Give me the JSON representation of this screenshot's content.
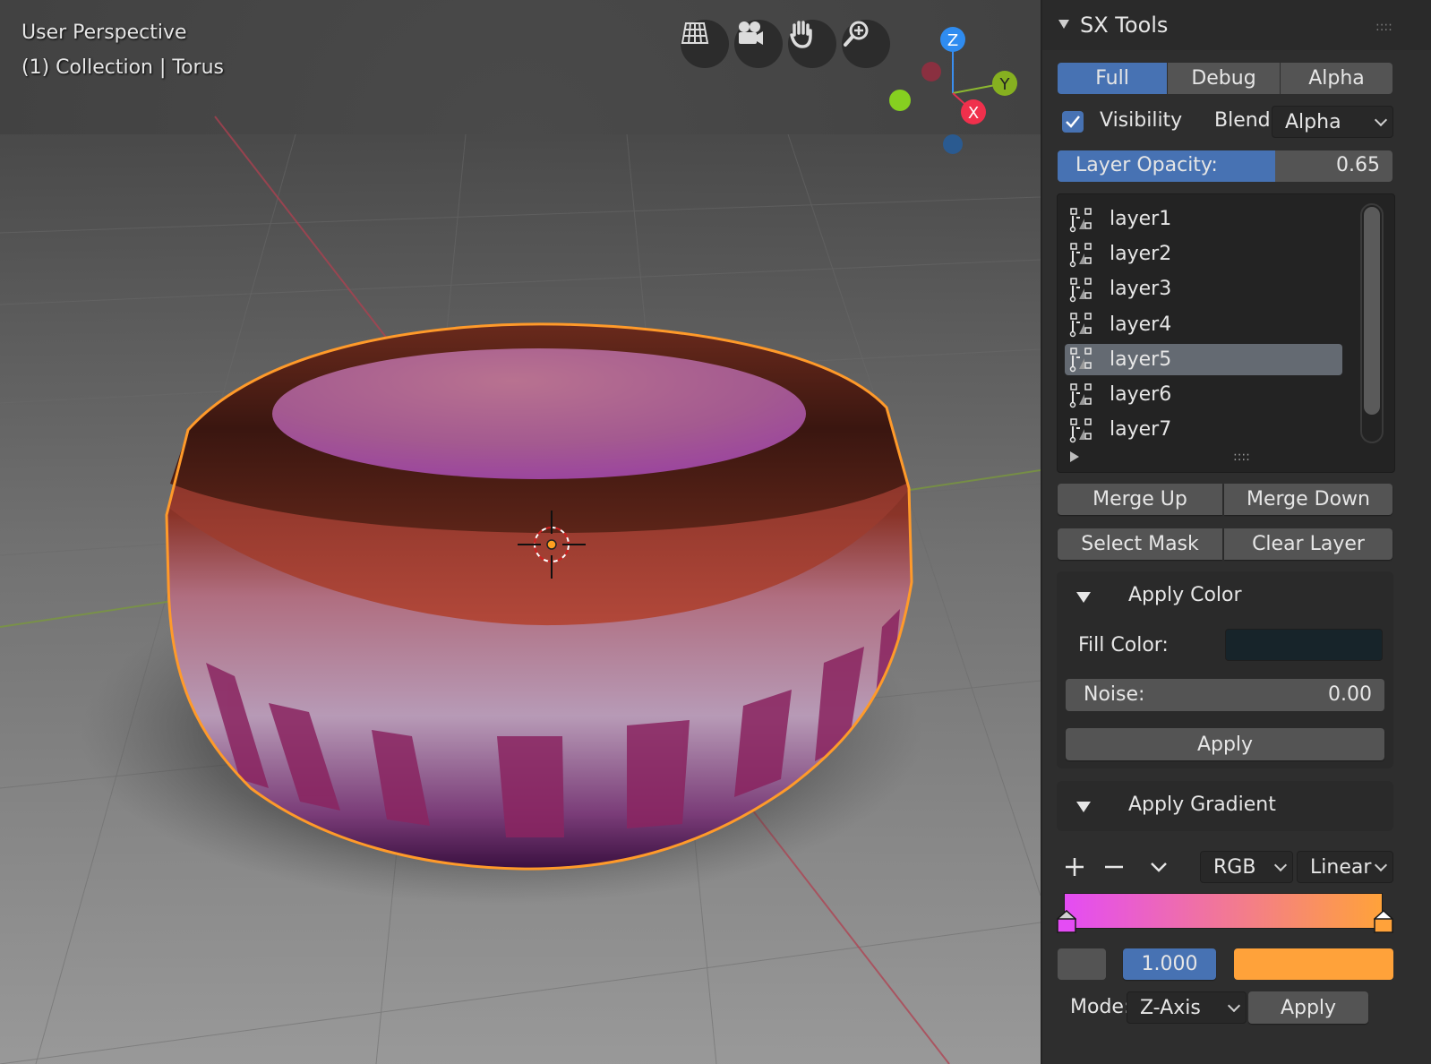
{
  "viewport": {
    "title": "User Perspective",
    "collection": "(1) Collection | Torus",
    "gizmo": {
      "z": "Z",
      "y": "Y",
      "x": "X"
    },
    "nav_icons": [
      "grid-icon",
      "camera-icon",
      "hand-icon",
      "zoom-icon"
    ]
  },
  "panel": {
    "title": "SX Tools",
    "modes": [
      "Full",
      "Debug",
      "Alpha"
    ],
    "active_mode": "Full",
    "visibility_label": "Visibility",
    "visibility_checked": true,
    "blend_label": "Blend",
    "blend_value": "Alpha",
    "opacity_label": "Layer Opacity:",
    "opacity_value": "0.65",
    "opacity_fraction": 0.65,
    "layers": [
      "layer1",
      "layer2",
      "layer3",
      "layer4",
      "layer5",
      "layer6",
      "layer7"
    ],
    "selected_layer": "layer5",
    "list_grip": "::::",
    "merge_up": "Merge Up",
    "merge_down": "Merge Down",
    "select_mask": "Select Mask",
    "clear_layer": "Clear Layer",
    "apply_color": {
      "title": "Apply Color",
      "fill_label": "Fill Color:",
      "fill_color": "#17242a",
      "noise_label": "Noise:",
      "noise_value": "0.00",
      "apply": "Apply"
    },
    "apply_gradient": {
      "title": "Apply Gradient",
      "color_mode": "RGB",
      "interpolation": "Linear",
      "gradient_start": "#e44cf4",
      "gradient_end": "#ffa23a",
      "position": "1.000",
      "stop_color": "#ffa23a",
      "mode_label": "Mode:",
      "mode_value": "Z-Axis",
      "apply": "Apply"
    }
  }
}
